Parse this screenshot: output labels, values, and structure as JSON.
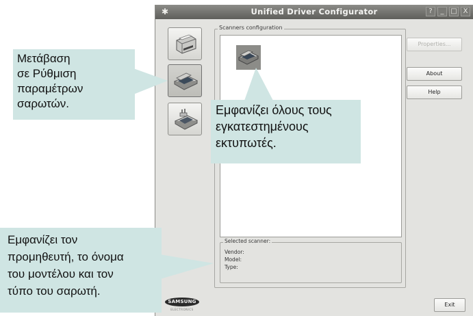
{
  "window": {
    "title": "Unified Driver Configurator",
    "title_buttons": [
      "?",
      "_",
      "□",
      "X"
    ]
  },
  "sidebar": {
    "items": [
      {
        "name": "printers-configuration",
        "icon": "printer-icon"
      },
      {
        "name": "scanners-configuration",
        "icon": "scanner-icon",
        "active": true
      },
      {
        "name": "ports-configuration",
        "icon": "port-icon"
      }
    ]
  },
  "scanners": {
    "group_label": "Scanners configuration",
    "items": [
      {
        "icon": "scanner-icon"
      }
    ]
  },
  "buttons": {
    "properties": "Properties...",
    "about": "About",
    "help": "Help",
    "exit": "Exit"
  },
  "selected_scanner": {
    "label": "Selected scanner:",
    "vendor": "Vendor:",
    "model": "Model:",
    "type": "Type:"
  },
  "logo": {
    "brand": "SAMSUNG",
    "sub": "ELECTRONICS"
  },
  "callouts": {
    "switch": {
      "lines": [
        "Μετάβαση",
        "σε Ρύθμιση",
        "παραμέτρων",
        "σαρωτών."
      ]
    },
    "list": {
      "lines": [
        "Εμφανίζει όλους τους",
        "εγκατεστημένους",
        "εκτυπωτές."
      ]
    },
    "details": {
      "lines": [
        "Εμφανίζει τον",
        "προμηθευτή, το όνομα",
        "του μοντέλου και τον",
        "τύπο του σαρωτή."
      ]
    }
  },
  "colors": {
    "callout_bg": "#cfe5e3",
    "window_bg": "#e3e3e0",
    "titlebar": "#6e6e6a"
  }
}
